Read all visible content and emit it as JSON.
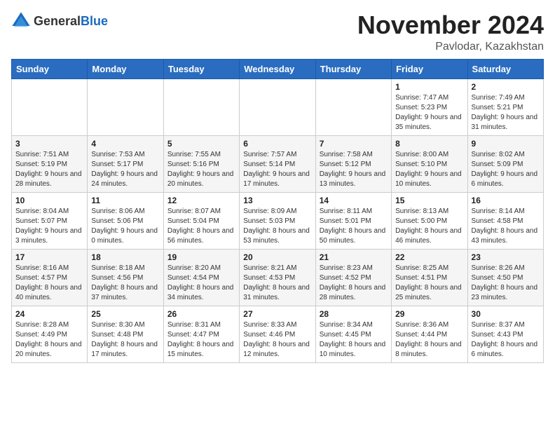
{
  "logo": {
    "text_general": "General",
    "text_blue": "Blue"
  },
  "title": {
    "month": "November 2024",
    "location": "Pavlodar, Kazakhstan"
  },
  "weekdays": [
    "Sunday",
    "Monday",
    "Tuesday",
    "Wednesday",
    "Thursday",
    "Friday",
    "Saturday"
  ],
  "weeks": [
    [
      {
        "day": "",
        "info": ""
      },
      {
        "day": "",
        "info": ""
      },
      {
        "day": "",
        "info": ""
      },
      {
        "day": "",
        "info": ""
      },
      {
        "day": "",
        "info": ""
      },
      {
        "day": "1",
        "info": "Sunrise: 7:47 AM\nSunset: 5:23 PM\nDaylight: 9 hours and 35 minutes."
      },
      {
        "day": "2",
        "info": "Sunrise: 7:49 AM\nSunset: 5:21 PM\nDaylight: 9 hours and 31 minutes."
      }
    ],
    [
      {
        "day": "3",
        "info": "Sunrise: 7:51 AM\nSunset: 5:19 PM\nDaylight: 9 hours and 28 minutes."
      },
      {
        "day": "4",
        "info": "Sunrise: 7:53 AM\nSunset: 5:17 PM\nDaylight: 9 hours and 24 minutes."
      },
      {
        "day": "5",
        "info": "Sunrise: 7:55 AM\nSunset: 5:16 PM\nDaylight: 9 hours and 20 minutes."
      },
      {
        "day": "6",
        "info": "Sunrise: 7:57 AM\nSunset: 5:14 PM\nDaylight: 9 hours and 17 minutes."
      },
      {
        "day": "7",
        "info": "Sunrise: 7:58 AM\nSunset: 5:12 PM\nDaylight: 9 hours and 13 minutes."
      },
      {
        "day": "8",
        "info": "Sunrise: 8:00 AM\nSunset: 5:10 PM\nDaylight: 9 hours and 10 minutes."
      },
      {
        "day": "9",
        "info": "Sunrise: 8:02 AM\nSunset: 5:09 PM\nDaylight: 9 hours and 6 minutes."
      }
    ],
    [
      {
        "day": "10",
        "info": "Sunrise: 8:04 AM\nSunset: 5:07 PM\nDaylight: 9 hours and 3 minutes."
      },
      {
        "day": "11",
        "info": "Sunrise: 8:06 AM\nSunset: 5:06 PM\nDaylight: 9 hours and 0 minutes."
      },
      {
        "day": "12",
        "info": "Sunrise: 8:07 AM\nSunset: 5:04 PM\nDaylight: 8 hours and 56 minutes."
      },
      {
        "day": "13",
        "info": "Sunrise: 8:09 AM\nSunset: 5:03 PM\nDaylight: 8 hours and 53 minutes."
      },
      {
        "day": "14",
        "info": "Sunrise: 8:11 AM\nSunset: 5:01 PM\nDaylight: 8 hours and 50 minutes."
      },
      {
        "day": "15",
        "info": "Sunrise: 8:13 AM\nSunset: 5:00 PM\nDaylight: 8 hours and 46 minutes."
      },
      {
        "day": "16",
        "info": "Sunrise: 8:14 AM\nSunset: 4:58 PM\nDaylight: 8 hours and 43 minutes."
      }
    ],
    [
      {
        "day": "17",
        "info": "Sunrise: 8:16 AM\nSunset: 4:57 PM\nDaylight: 8 hours and 40 minutes."
      },
      {
        "day": "18",
        "info": "Sunrise: 8:18 AM\nSunset: 4:56 PM\nDaylight: 8 hours and 37 minutes."
      },
      {
        "day": "19",
        "info": "Sunrise: 8:20 AM\nSunset: 4:54 PM\nDaylight: 8 hours and 34 minutes."
      },
      {
        "day": "20",
        "info": "Sunrise: 8:21 AM\nSunset: 4:53 PM\nDaylight: 8 hours and 31 minutes."
      },
      {
        "day": "21",
        "info": "Sunrise: 8:23 AM\nSunset: 4:52 PM\nDaylight: 8 hours and 28 minutes."
      },
      {
        "day": "22",
        "info": "Sunrise: 8:25 AM\nSunset: 4:51 PM\nDaylight: 8 hours and 25 minutes."
      },
      {
        "day": "23",
        "info": "Sunrise: 8:26 AM\nSunset: 4:50 PM\nDaylight: 8 hours and 23 minutes."
      }
    ],
    [
      {
        "day": "24",
        "info": "Sunrise: 8:28 AM\nSunset: 4:49 PM\nDaylight: 8 hours and 20 minutes."
      },
      {
        "day": "25",
        "info": "Sunrise: 8:30 AM\nSunset: 4:48 PM\nDaylight: 8 hours and 17 minutes."
      },
      {
        "day": "26",
        "info": "Sunrise: 8:31 AM\nSunset: 4:47 PM\nDaylight: 8 hours and 15 minutes."
      },
      {
        "day": "27",
        "info": "Sunrise: 8:33 AM\nSunset: 4:46 PM\nDaylight: 8 hours and 12 minutes."
      },
      {
        "day": "28",
        "info": "Sunrise: 8:34 AM\nSunset: 4:45 PM\nDaylight: 8 hours and 10 minutes."
      },
      {
        "day": "29",
        "info": "Sunrise: 8:36 AM\nSunset: 4:44 PM\nDaylight: 8 hours and 8 minutes."
      },
      {
        "day": "30",
        "info": "Sunrise: 8:37 AM\nSunset: 4:43 PM\nDaylight: 8 hours and 6 minutes."
      }
    ]
  ]
}
